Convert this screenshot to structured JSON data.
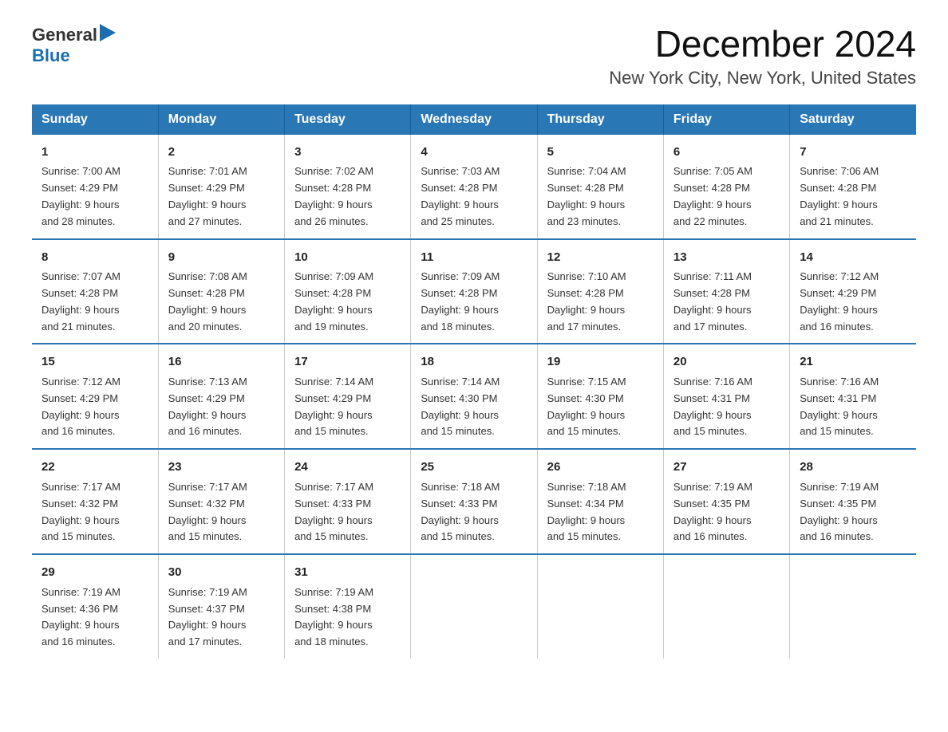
{
  "header": {
    "logo_general": "General",
    "logo_blue": "Blue",
    "title": "December 2024",
    "subtitle": "New York City, New York, United States"
  },
  "calendar": {
    "days_of_week": [
      "Sunday",
      "Monday",
      "Tuesday",
      "Wednesday",
      "Thursday",
      "Friday",
      "Saturday"
    ],
    "weeks": [
      [
        {
          "day": "1",
          "sunrise": "7:00 AM",
          "sunset": "4:29 PM",
          "daylight": "9 hours and 28 minutes."
        },
        {
          "day": "2",
          "sunrise": "7:01 AM",
          "sunset": "4:29 PM",
          "daylight": "9 hours and 27 minutes."
        },
        {
          "day": "3",
          "sunrise": "7:02 AM",
          "sunset": "4:28 PM",
          "daylight": "9 hours and 26 minutes."
        },
        {
          "day": "4",
          "sunrise": "7:03 AM",
          "sunset": "4:28 PM",
          "daylight": "9 hours and 25 minutes."
        },
        {
          "day": "5",
          "sunrise": "7:04 AM",
          "sunset": "4:28 PM",
          "daylight": "9 hours and 23 minutes."
        },
        {
          "day": "6",
          "sunrise": "7:05 AM",
          "sunset": "4:28 PM",
          "daylight": "9 hours and 22 minutes."
        },
        {
          "day": "7",
          "sunrise": "7:06 AM",
          "sunset": "4:28 PM",
          "daylight": "9 hours and 21 minutes."
        }
      ],
      [
        {
          "day": "8",
          "sunrise": "7:07 AM",
          "sunset": "4:28 PM",
          "daylight": "9 hours and 21 minutes."
        },
        {
          "day": "9",
          "sunrise": "7:08 AM",
          "sunset": "4:28 PM",
          "daylight": "9 hours and 20 minutes."
        },
        {
          "day": "10",
          "sunrise": "7:09 AM",
          "sunset": "4:28 PM",
          "daylight": "9 hours and 19 minutes."
        },
        {
          "day": "11",
          "sunrise": "7:09 AM",
          "sunset": "4:28 PM",
          "daylight": "9 hours and 18 minutes."
        },
        {
          "day": "12",
          "sunrise": "7:10 AM",
          "sunset": "4:28 PM",
          "daylight": "9 hours and 17 minutes."
        },
        {
          "day": "13",
          "sunrise": "7:11 AM",
          "sunset": "4:28 PM",
          "daylight": "9 hours and 17 minutes."
        },
        {
          "day": "14",
          "sunrise": "7:12 AM",
          "sunset": "4:29 PM",
          "daylight": "9 hours and 16 minutes."
        }
      ],
      [
        {
          "day": "15",
          "sunrise": "7:12 AM",
          "sunset": "4:29 PM",
          "daylight": "9 hours and 16 minutes."
        },
        {
          "day": "16",
          "sunrise": "7:13 AM",
          "sunset": "4:29 PM",
          "daylight": "9 hours and 16 minutes."
        },
        {
          "day": "17",
          "sunrise": "7:14 AM",
          "sunset": "4:29 PM",
          "daylight": "9 hours and 15 minutes."
        },
        {
          "day": "18",
          "sunrise": "7:14 AM",
          "sunset": "4:30 PM",
          "daylight": "9 hours and 15 minutes."
        },
        {
          "day": "19",
          "sunrise": "7:15 AM",
          "sunset": "4:30 PM",
          "daylight": "9 hours and 15 minutes."
        },
        {
          "day": "20",
          "sunrise": "7:16 AM",
          "sunset": "4:31 PM",
          "daylight": "9 hours and 15 minutes."
        },
        {
          "day": "21",
          "sunrise": "7:16 AM",
          "sunset": "4:31 PM",
          "daylight": "9 hours and 15 minutes."
        }
      ],
      [
        {
          "day": "22",
          "sunrise": "7:17 AM",
          "sunset": "4:32 PM",
          "daylight": "9 hours and 15 minutes."
        },
        {
          "day": "23",
          "sunrise": "7:17 AM",
          "sunset": "4:32 PM",
          "daylight": "9 hours and 15 minutes."
        },
        {
          "day": "24",
          "sunrise": "7:17 AM",
          "sunset": "4:33 PM",
          "daylight": "9 hours and 15 minutes."
        },
        {
          "day": "25",
          "sunrise": "7:18 AM",
          "sunset": "4:33 PM",
          "daylight": "9 hours and 15 minutes."
        },
        {
          "day": "26",
          "sunrise": "7:18 AM",
          "sunset": "4:34 PM",
          "daylight": "9 hours and 15 minutes."
        },
        {
          "day": "27",
          "sunrise": "7:19 AM",
          "sunset": "4:35 PM",
          "daylight": "9 hours and 16 minutes."
        },
        {
          "day": "28",
          "sunrise": "7:19 AM",
          "sunset": "4:35 PM",
          "daylight": "9 hours and 16 minutes."
        }
      ],
      [
        {
          "day": "29",
          "sunrise": "7:19 AM",
          "sunset": "4:36 PM",
          "daylight": "9 hours and 16 minutes."
        },
        {
          "day": "30",
          "sunrise": "7:19 AM",
          "sunset": "4:37 PM",
          "daylight": "9 hours and 17 minutes."
        },
        {
          "day": "31",
          "sunrise": "7:19 AM",
          "sunset": "4:38 PM",
          "daylight": "9 hours and 18 minutes."
        },
        null,
        null,
        null,
        null
      ]
    ],
    "labels": {
      "sunrise": "Sunrise: ",
      "sunset": "Sunset: ",
      "daylight": "Daylight: "
    }
  }
}
